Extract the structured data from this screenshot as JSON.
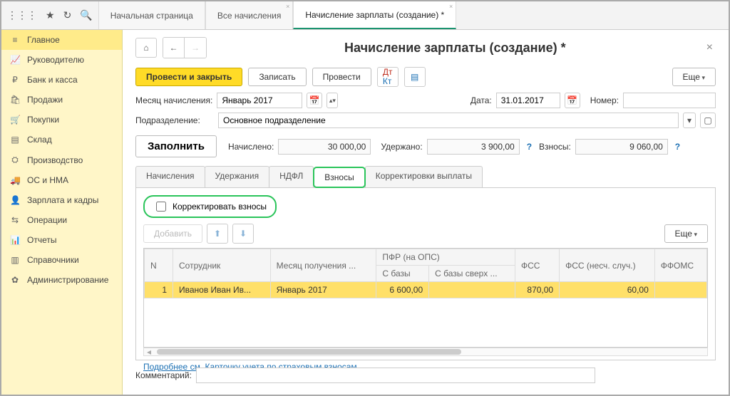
{
  "topTabs": {
    "home": "Начальная страница",
    "all": "Все начисления",
    "current": "Начисление зарплаты (создание) *"
  },
  "sidebar": {
    "items": [
      {
        "icon": "≡",
        "label": "Главное"
      },
      {
        "icon": "📈",
        "label": "Руководителю"
      },
      {
        "icon": "₽",
        "label": "Банк и касса"
      },
      {
        "icon": "🛍",
        "label": "Продажи"
      },
      {
        "icon": "🛒",
        "label": "Покупки"
      },
      {
        "icon": "▤",
        "label": "Склад"
      },
      {
        "icon": "⛭",
        "label": "Производство"
      },
      {
        "icon": "🚚",
        "label": "ОС и НМА"
      },
      {
        "icon": "👤",
        "label": "Зарплата и кадры"
      },
      {
        "icon": "⇆",
        "label": "Операции"
      },
      {
        "icon": "📊",
        "label": "Отчеты"
      },
      {
        "icon": "▥",
        "label": "Справочники"
      },
      {
        "icon": "✿",
        "label": "Администрирование"
      }
    ]
  },
  "header": {
    "title": "Начисление зарплаты (создание) *"
  },
  "toolbar": {
    "post_close": "Провести и закрыть",
    "write": "Записать",
    "post": "Провести",
    "more": "Еще"
  },
  "form": {
    "month_label": "Месяц начисления:",
    "month_value": "Январь 2017",
    "date_label": "Дата:",
    "date_value": "31.01.2017",
    "number_label": "Номер:",
    "number_value": "",
    "dept_label": "Подразделение:",
    "dept_value": "Основное подразделение",
    "fill": "Заполнить",
    "accrued_label": "Начислено:",
    "accrued_value": "30 000,00",
    "withheld_label": "Удержано:",
    "withheld_value": "3 900,00",
    "contrib_label": "Взносы:",
    "contrib_value": "9 060,00"
  },
  "tabs": {
    "t1": "Начисления",
    "t2": "Удержания",
    "t3": "НДФЛ",
    "t4": "Взносы",
    "t5": "Корректировки выплаты"
  },
  "panel": {
    "correct_label": "Корректировать взносы",
    "add": "Добавить",
    "more": "Еще"
  },
  "grid": {
    "cols": {
      "n": "N",
      "emp": "Сотрудник",
      "month": "Месяц получения ...",
      "pfr": "ПФР (на ОПС)",
      "pfr_base": "С базы",
      "pfr_over": "С базы сверх ...",
      "fss": "ФСС",
      "fss_ns": "ФСС (несч. случ.)",
      "ffoms": "ФФОМС"
    },
    "row": {
      "n": "1",
      "emp": "Иванов Иван Ив...",
      "month": "Январь 2017",
      "pfr_base": "6 600,00",
      "pfr_over": "",
      "fss": "870,00",
      "fss_ns": "60,00",
      "ffoms": ""
    }
  },
  "link": "Подробнее см. Карточку учета по страховым взносам",
  "comment_label": "Комментарий:",
  "comment_value": ""
}
